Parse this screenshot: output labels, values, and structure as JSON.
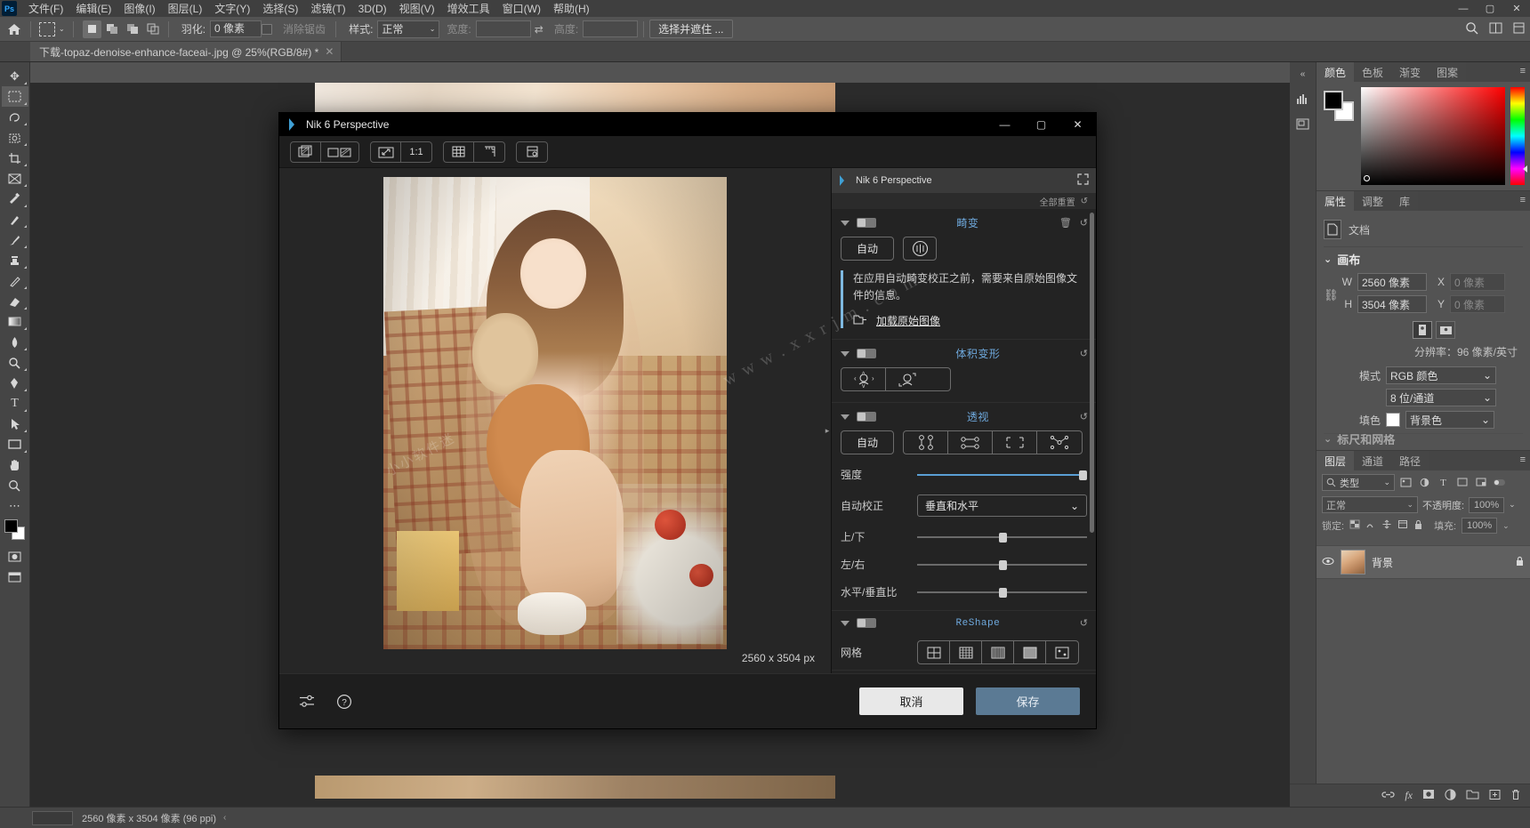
{
  "app": {
    "logo": "Ps",
    "menus": [
      "文件(F)",
      "编辑(E)",
      "图像(I)",
      "图层(L)",
      "文字(Y)",
      "选择(S)",
      "滤镜(T)",
      "3D(D)",
      "视图(V)",
      "增效工具",
      "窗口(W)",
      "帮助(H)"
    ],
    "window_controls": {
      "minimize": "—",
      "maximize": "▢",
      "close": "✕"
    }
  },
  "options_bar": {
    "home_icon": "home-icon",
    "tool_icon": "rectangular-marquee-icon",
    "dropdown_caret": "⌄",
    "selection_modes": [
      "new-selection",
      "add-to-selection",
      "subtract-from-selection",
      "intersect-selection"
    ],
    "feather_label": "羽化:",
    "feather_value": "0 像素",
    "antialias_label": "消除锯齿",
    "style_label": "样式:",
    "style_value": "正常",
    "width_label": "宽度:",
    "width_value": "",
    "swap_icon": "swap-arrows-icon",
    "height_label": "高度:",
    "height_value": "",
    "select_mask_button": "选择并遮住 ...",
    "search_icon": "search-icon",
    "arrange_icon": "arrange-documents-icon",
    "workspace_icon": "workspace-switcher-icon"
  },
  "document_tab": {
    "title": "下载-topaz-denoise-enhance-faceai-.jpg @ 25%(RGB/8#) *",
    "close": "✕"
  },
  "tools": [
    {
      "name": "move-tool",
      "glyph": "✥"
    },
    {
      "name": "rectangular-marquee-tool",
      "glyph": "▭"
    },
    {
      "name": "lasso-tool",
      "glyph": "◠"
    },
    {
      "name": "object-selection-tool",
      "glyph": "⌘"
    },
    {
      "name": "crop-tool",
      "glyph": "⌗"
    },
    {
      "name": "frame-tool",
      "glyph": "⊠"
    },
    {
      "name": "eyedropper-tool",
      "glyph": "⌇"
    },
    {
      "name": "spot-healing-brush-tool",
      "glyph": "✒"
    },
    {
      "name": "brush-tool",
      "glyph": "🖌"
    },
    {
      "name": "clone-stamp-tool",
      "glyph": "♗"
    },
    {
      "name": "history-brush-tool",
      "glyph": "✎"
    },
    {
      "name": "eraser-tool",
      "glyph": "◧"
    },
    {
      "name": "gradient-tool",
      "glyph": "▤"
    },
    {
      "name": "blur-tool",
      "glyph": "💧"
    },
    {
      "name": "dodge-tool",
      "glyph": "◐"
    },
    {
      "name": "pen-tool",
      "glyph": "✐"
    },
    {
      "name": "type-tool",
      "glyph": "T"
    },
    {
      "name": "path-selection-tool",
      "glyph": "➤"
    },
    {
      "name": "rectangle-tool",
      "glyph": "▢"
    },
    {
      "name": "hand-tool",
      "glyph": "✋"
    },
    {
      "name": "zoom-tool",
      "glyph": "🔍"
    },
    {
      "name": "edit-toolbar-tool",
      "glyph": "⋯"
    }
  ],
  "status_bar": {
    "zoom_value": "",
    "doc_info": "2560 像素 x 3504 像素 (96 ppi)",
    "arrow": "‹"
  },
  "nik_dialog": {
    "title": "Nik 6 Perspective",
    "window_controls": {
      "minimize": "—",
      "maximize": "▢",
      "close": "✕"
    },
    "toolbar": [
      {
        "name": "compare-view-icon",
        "glyph": "▨"
      },
      {
        "name": "split-view-icon",
        "glyph": "▭▨"
      },
      {
        "name": "fit-to-screen-icon",
        "glyph": "⤢"
      },
      {
        "name": "zoom-1-to-1",
        "label": "1:1"
      },
      {
        "name": "grid-overlay-icon",
        "glyph": "▦"
      },
      {
        "name": "ruler-overlay-icon",
        "glyph": "📏"
      },
      {
        "name": "settings-preset-icon",
        "glyph": "▤"
      }
    ],
    "preview": {
      "dimensions": "2560 x 3504 px",
      "expander": "▸"
    },
    "panel_header": {
      "title": "Nik 6 Perspective",
      "expand_icon": "expand-icon"
    },
    "reset_all": {
      "label": "全部重置",
      "icon": "↺"
    },
    "sections": [
      {
        "id": "distortion",
        "title": "畸变",
        "toggle_on": true,
        "actions": [
          "🗑",
          "↺"
        ],
        "auto_button": "自动",
        "lens_button_icon": "lens-profile-icon",
        "info_text": "在应用自动畸变校正之前，需要来自原始图像文件的信息。",
        "load_link": "加载原始图像",
        "folder_icon": "folder-open-icon"
      },
      {
        "id": "volume-deformation",
        "title": "体积变形",
        "toggle_on": true,
        "actions": [
          "↺"
        ],
        "buttons": [
          "volume-global-icon",
          "volume-local-icon"
        ]
      },
      {
        "id": "perspective",
        "title": "透视",
        "toggle_on": true,
        "actions": [
          "↺"
        ],
        "auto_button": "自动",
        "tool_buttons": [
          "vertical-lines-icon",
          "horizontal-lines-icon",
          "rectangle-corners-icon",
          "four-points-icon"
        ],
        "strength_label": "强度",
        "strength_value": 100,
        "autocorrect_label": "自动校正",
        "autocorrect_value": "垂直和水平",
        "sliders": [
          {
            "label": "上/下",
            "value": 50
          },
          {
            "label": "左/右",
            "value": 50
          },
          {
            "label": "水平/垂直比",
            "value": 50
          }
        ]
      },
      {
        "id": "reshape",
        "title": "ReShape",
        "toggle_on": true,
        "actions": [
          "↺"
        ],
        "grid_label": "网格",
        "grid_options": [
          "grid-2x2-icon",
          "grid-4x4-icon",
          "grid-6x6-icon",
          "grid-solid-icon",
          "grid-custom-icon"
        ]
      }
    ],
    "footer": {
      "settings_icon": "sliders-icon",
      "help_icon": "help-icon",
      "cancel_button": "取消",
      "save_button": "保存"
    }
  },
  "right_dock": {
    "collapse_icon": "«",
    "rail_icons": [
      "histogram-icon",
      "navigator-icon"
    ],
    "color_panel": {
      "tabs": [
        "颜色",
        "色板",
        "渐变",
        "图案"
      ],
      "active_tab": "颜色",
      "menu_icon": "≡",
      "foreground": "#000000",
      "background": "#ffffff"
    },
    "properties_panel": {
      "tabs": [
        "属性",
        "调整",
        "库"
      ],
      "active_tab": "属性",
      "menu_icon": "≡",
      "doc_label": "文档",
      "doc_icon": "document-icon",
      "canvas_section": "画布",
      "width_label": "W",
      "width_value": "2560 像素",
      "x_label": "X",
      "x_value": "0 像素",
      "height_label": "H",
      "height_value": "3504 像素",
      "y_label": "Y",
      "y_value": "0 像素",
      "link_icon": "link-icon",
      "orientation": [
        "portrait-icon",
        "landscape-icon"
      ],
      "resolution_line": "分辨率：96 像素/英寸",
      "mode_label": "模式",
      "mode_value": "RGB 颜色",
      "depth_value": "8 位/通道",
      "fill_label": "填色",
      "fill_value": "背景色",
      "next_section": "标尺和网格"
    },
    "layers_panel": {
      "tabs": [
        "图层",
        "通道",
        "路径"
      ],
      "active_tab": "图层",
      "menu_icon": "≡",
      "filter_label": "类型",
      "filter_icon": "search-icon",
      "filter_buttons": [
        "pixel-filter-icon",
        "adjustment-filter-icon",
        "type-filter-icon",
        "shape-filter-icon",
        "smart-object-filter-icon"
      ],
      "filter_toggle": "filter-toggle-icon",
      "blend_mode": "正常",
      "opacity_label": "不透明度:",
      "opacity_value": "100%",
      "lock_label": "锁定:",
      "lock_icons": [
        "lock-transparent-icon",
        "lock-image-icon",
        "lock-position-icon",
        "lock-artboard-icon",
        "lock-all-icon"
      ],
      "fill_label": "填充:",
      "fill_value": "100%",
      "layers": [
        {
          "visible": true,
          "eye_icon": "eye-icon",
          "name": "背景",
          "locked": true,
          "lock_icon": "lock-icon"
        }
      ],
      "footer_icons": [
        "link-layers-icon",
        "layer-style-icon",
        "layer-mask-icon",
        "adjustment-layer-icon",
        "new-group-icon",
        "new-layer-icon",
        "delete-layer-icon"
      ]
    }
  },
  "watermarks": [
    "w w w . x x r j m . c o m",
    "小小软件迷"
  ]
}
